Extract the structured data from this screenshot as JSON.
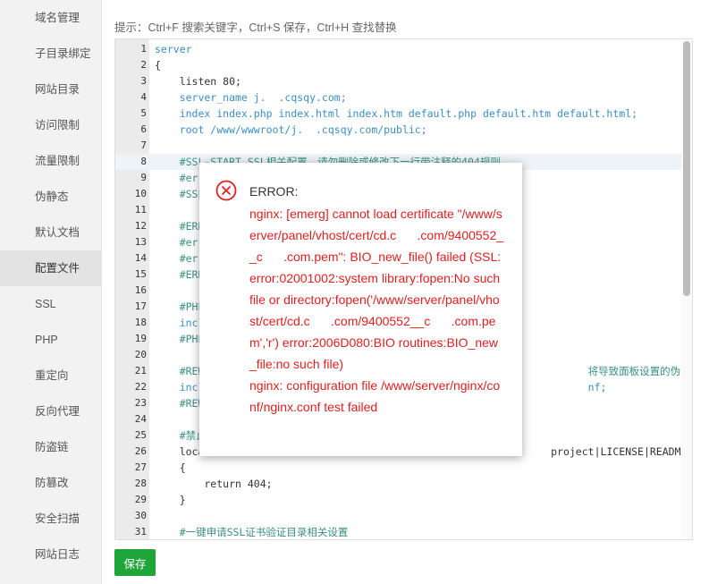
{
  "sidebar": {
    "items": [
      {
        "label": "域名管理",
        "active": false
      },
      {
        "label": "子目录绑定",
        "active": false
      },
      {
        "label": "网站目录",
        "active": false
      },
      {
        "label": "访问限制",
        "active": false
      },
      {
        "label": "流量限制",
        "active": false
      },
      {
        "label": "伪静态",
        "active": false
      },
      {
        "label": "默认文档",
        "active": false
      },
      {
        "label": "配置文件",
        "active": true
      },
      {
        "label": "SSL",
        "active": false
      },
      {
        "label": "PHP",
        "active": false
      },
      {
        "label": "重定向",
        "active": false
      },
      {
        "label": "反向代理",
        "active": false
      },
      {
        "label": "防盗链",
        "active": false
      },
      {
        "label": "防篡改",
        "active": false
      },
      {
        "label": "安全扫描",
        "active": false
      },
      {
        "label": "网站日志",
        "active": false
      }
    ]
  },
  "hint": "提示：Ctrl+F 搜索关键字，Ctrl+S 保存，Ctrl+H 查找替换",
  "editor": {
    "lines": [
      {
        "n": "1",
        "text": "server",
        "cls": "kw"
      },
      {
        "n": "2",
        "text": "{",
        "cls": ""
      },
      {
        "n": "3",
        "text": "    listen 80;",
        "cls": ""
      },
      {
        "n": "4",
        "text": "    server_name j.  .cqsqy.com;",
        "cls": "kw"
      },
      {
        "n": "5",
        "text": "    index index.php index.html index.htm default.php default.htm default.html;",
        "cls": "kw"
      },
      {
        "n": "6",
        "text": "    root /www/wwwroot/j.  .cqsqy.com/public;",
        "cls": "kw"
      },
      {
        "n": "7",
        "text": "",
        "cls": ""
      },
      {
        "n": "8",
        "text": "    #SSL-START SSL相关配置，请勿删除或修改下一行带注释的404规则",
        "cls": "cmt"
      },
      {
        "n": "9",
        "text": "    #err",
        "cls": "cmt"
      },
      {
        "n": "10",
        "text": "    #SSL",
        "cls": "cmt"
      },
      {
        "n": "11",
        "text": "",
        "cls": ""
      },
      {
        "n": "12",
        "text": "    #ERR",
        "cls": "cmt"
      },
      {
        "n": "13",
        "text": "    #err",
        "cls": "cmt"
      },
      {
        "n": "14",
        "text": "    #err",
        "cls": "cmt"
      },
      {
        "n": "15",
        "text": "    #ERR",
        "cls": "cmt"
      },
      {
        "n": "16",
        "text": "",
        "cls": ""
      },
      {
        "n": "17",
        "text": "    #PHP",
        "cls": "cmt"
      },
      {
        "n": "18",
        "text": "    incl",
        "cls": "kw"
      },
      {
        "n": "19",
        "text": "    #PHP",
        "cls": "cmt"
      },
      {
        "n": "20",
        "text": "",
        "cls": ""
      },
      {
        "n": "21",
        "text": "    #REW                                                              将导致面板设置的伪静态规则失效",
        "cls": "cmt"
      },
      {
        "n": "22",
        "text": "    incl                                                              nf;",
        "cls": "kw"
      },
      {
        "n": "23",
        "text": "    #REW",
        "cls": "cmt"
      },
      {
        "n": "24",
        "text": "",
        "cls": ""
      },
      {
        "n": "25",
        "text": "    #禁止",
        "cls": "cmt"
      },
      {
        "n": "26",
        "text": "    loca                                                        project|LICENSE|README.md)",
        "cls": ""
      },
      {
        "n": "27",
        "text": "    {",
        "cls": ""
      },
      {
        "n": "28",
        "text": "        return 404;",
        "cls": ""
      },
      {
        "n": "29",
        "text": "    }",
        "cls": ""
      },
      {
        "n": "30",
        "text": "",
        "cls": ""
      },
      {
        "n": "31",
        "text": "    #一键申请SSL证书验证目录相关设置",
        "cls": "cmt"
      }
    ]
  },
  "save_label": "保存",
  "dialog": {
    "title": "ERROR:",
    "message": "nginx: [emerg] cannot load certificate \"/www/server/panel/vhost/cert/cd.c      .com/9400552__c      .com.pem\": BIO_new_file() failed (SSL: error:02001002:system library:fopen:No such file or directory:fopen('/www/server/panel/vhost/cert/cd.c      .com/9400552__c      .com.pem','r') error:2006D080:BIO routines:BIO_new_file:no such file)\nnginx: configuration file /www/server/nginx/conf/nginx.conf test failed",
    "colors": {
      "error": "#e02020",
      "icon": "#e02020"
    }
  }
}
